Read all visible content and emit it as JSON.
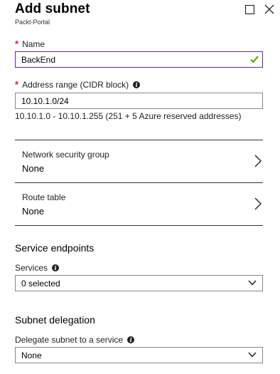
{
  "blade": {
    "title": "Add subnet",
    "subtitle": "Packt-Portal"
  },
  "name_field": {
    "required_mark": "*",
    "label": "Name",
    "value": "BackEnd",
    "valid_icon": "checkmark-icon"
  },
  "address_field": {
    "required_mark": "*",
    "label": "Address range (CIDR block)",
    "value": "10.10.1.0/24",
    "hint": "10.10.1.0 - 10.10.1.255 (251 + 5 Azure reserved addresses)"
  },
  "network_security_group": {
    "label": "Network security group",
    "value": "None"
  },
  "route_table": {
    "label": "Route table",
    "value": "None"
  },
  "service_endpoints": {
    "section_title": "Service endpoints",
    "services_label": "Services",
    "services_value": "0 selected"
  },
  "subnet_delegation": {
    "section_title": "Subnet delegation",
    "delegate_label": "Delegate subnet to a service",
    "delegate_value": "None"
  },
  "colors": {
    "required": "#c4262e",
    "valid_border": "#5c2d91",
    "valid_check": "#57a300"
  }
}
